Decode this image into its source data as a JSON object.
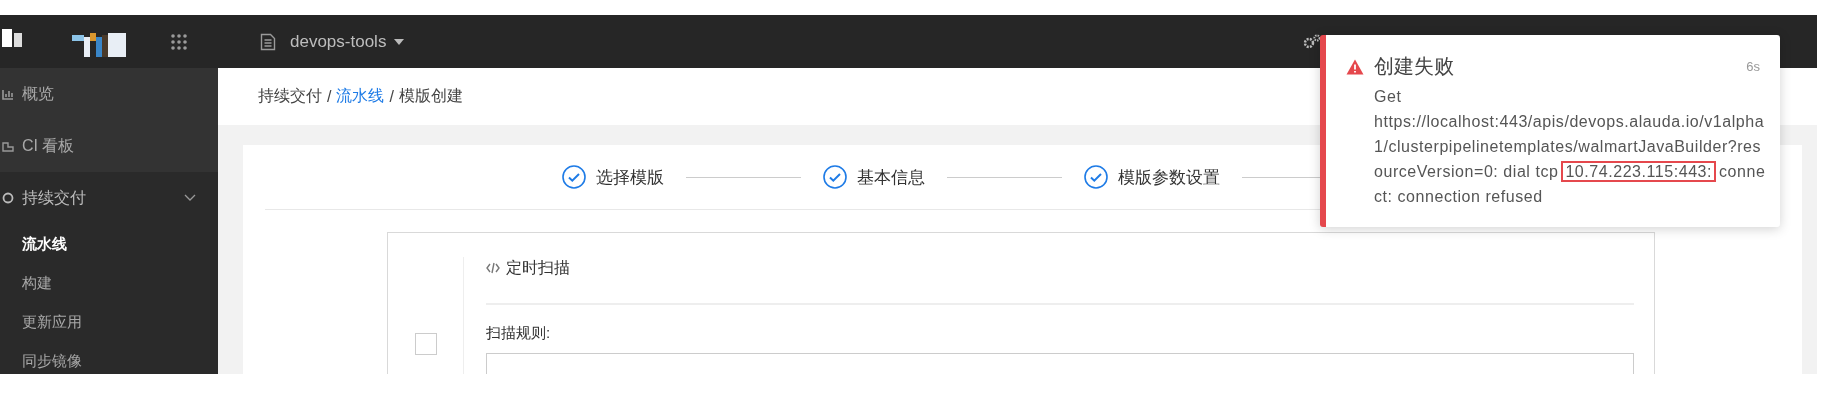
{
  "top_bar": {
    "project": "devops-tools"
  },
  "sidebar": {
    "items": [
      {
        "label": "概览"
      },
      {
        "label": "CI 看板"
      },
      {
        "label": "持续交付",
        "expanded": true,
        "children": [
          {
            "label": "流水线",
            "selected": true
          },
          {
            "label": "构建",
            "selected": false
          },
          {
            "label": "更新应用",
            "selected": false
          },
          {
            "label": "同步镜像",
            "selected": false
          }
        ]
      }
    ]
  },
  "breadcrumb": [
    {
      "label": "持续交付",
      "kind": "text"
    },
    {
      "label": "/",
      "kind": "separator"
    },
    {
      "label": "流水线",
      "kind": "link"
    },
    {
      "label": "/",
      "kind": "separator"
    },
    {
      "label": "模版创建",
      "kind": "text"
    }
  ],
  "steps": [
    {
      "label": "选择模版",
      "done": true
    },
    {
      "label": "基本信息",
      "done": true
    },
    {
      "label": "模版参数设置",
      "done": true
    }
  ],
  "form": {
    "enabled": false,
    "section_title": "定时扫描",
    "field_label": "扫描规则:"
  },
  "toast": {
    "title": "创建失败",
    "time": "6s",
    "message": {
      "prefix": "Get",
      "body": "https://localhost:443/apis/devops.alauda.io/v1alpha1/clusterpipelinetemplates/walmartJavaBuilder?resourceVersion=0: dial tcp",
      "highlight": "10.74.223.115:443:",
      "suffix": "connect: connection refused"
    }
  }
}
